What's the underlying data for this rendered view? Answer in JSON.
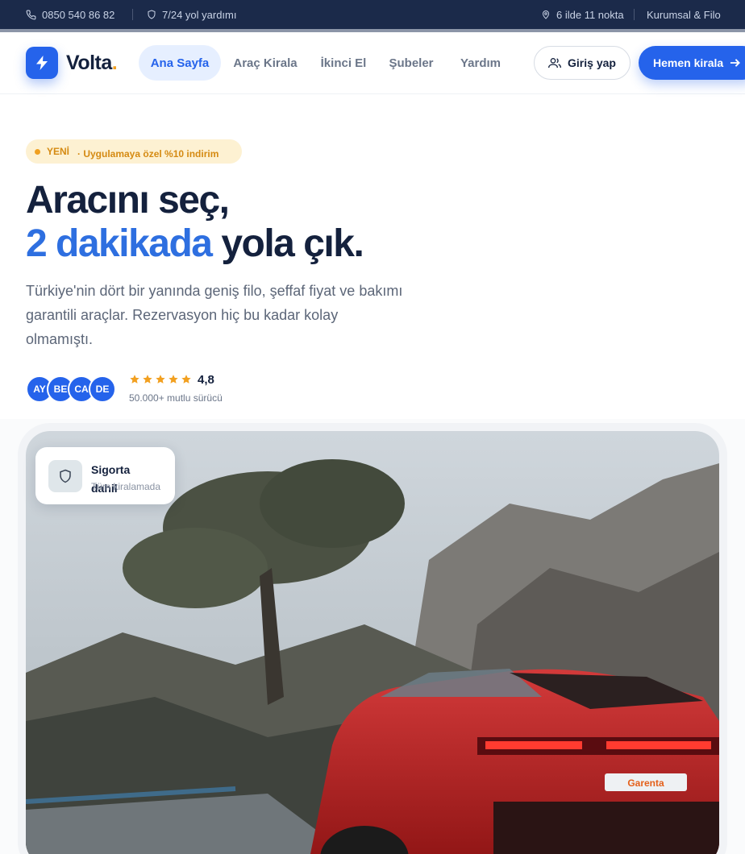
{
  "topbar": {
    "phone": "0850 540 86 82",
    "support": "7/24 yol yardımı",
    "locations": "6 ilde 11 nokta",
    "corporate": "Kurumsal & Filo"
  },
  "header": {
    "logo_text": "Volta",
    "logo_dot": ".",
    "nav": [
      {
        "label": "Ana Sayfa",
        "active": true
      },
      {
        "label": "Araç Kirala",
        "active": false
      },
      {
        "label": "İkinci El",
        "active": false
      },
      {
        "label": "Şubeler",
        "active": false
      },
      {
        "label": "Yardım",
        "active": false
      }
    ],
    "login_label": "Giriş yap",
    "rent_label": "Hemen kirala"
  },
  "hero": {
    "badge_new": "YENİ",
    "badge_text": "· Uygulamaya özel %10 indirim",
    "title_line1": "Aracını seç,",
    "title_highlight": "2 dakikada",
    "title_rest": "yola çık.",
    "lead": "Türkiye'nin dört bir yanında geniş filo, şeffaf fiyat ve bakımı garantili araçlar. Rezervasyon hiç bu kadar kolay olmamıştı.",
    "avatars": [
      "AY",
      "BE",
      "CA",
      "DE"
    ],
    "stars": 5,
    "rating": "4,8",
    "rating_sub": "50.000+ mutlu sürücü"
  },
  "insurance_card": {
    "title": "Sigorta dahil",
    "subtitle": "Tüm kiralamada"
  },
  "plate_text": "Garenta",
  "colors": {
    "brand_blue": "#2563eb",
    "navy": "#14213d",
    "topbar_bg": "#1b2a4a",
    "accent_orange": "#f2a020",
    "badge_bg": "#fdf1d2"
  }
}
